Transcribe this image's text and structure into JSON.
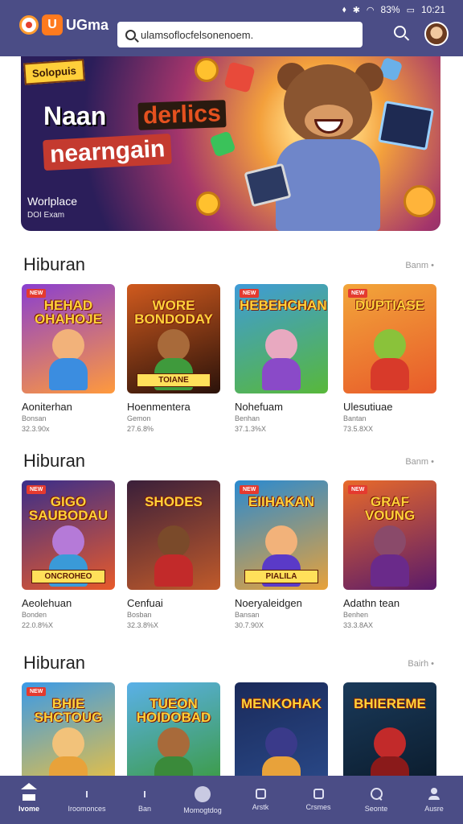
{
  "status_bar": {
    "battery": "83%",
    "time": "10:21"
  },
  "header": {
    "brand": "UGma",
    "search_value": "ulamsoflocfelsonenoem."
  },
  "banner": {
    "ribbon": "Solopuis",
    "title_line1_white": "Naan",
    "title_line1_box": "derlics",
    "title_line2": "nearngain",
    "subtitle": "Worlplace",
    "caption": "DOI Exam"
  },
  "sections": [
    {
      "title": "Hiburan",
      "more": "Banm",
      "cards": [
        {
          "art": "HEHAD OHAHOJE",
          "chip": "NEW",
          "foot": "",
          "name": "Aoniterhan",
          "meta1": "Bonsan",
          "meta2": "32.3.90x",
          "bg1": "#8a3fd0",
          "bg2": "#ff9a3c",
          "char": "#f2b27a",
          "body": "#3b8de0"
        },
        {
          "art": "WORE BONDODAY",
          "chip": "",
          "foot": "TOIANE",
          "name": "Hoenmentera",
          "meta1": "Gemon",
          "meta2": "27.6.8%",
          "bg1": "#d05a1e",
          "bg2": "#2a120a",
          "char": "#a86a3a",
          "body": "#3f9a3c"
        },
        {
          "art": "HEBEHCHAN",
          "chip": "NEW",
          "foot": "",
          "name": "Nohefuam",
          "meta1": "Benhan",
          "meta2": "37.1.3%X",
          "bg1": "#3f9bd8",
          "bg2": "#58b83a",
          "char": "#e8a9c0",
          "body": "#8a4ac8"
        },
        {
          "art": "DUPTIASE",
          "chip": "NEW",
          "foot": "",
          "name": "Ulesutiuae",
          "meta1": "Bantan",
          "meta2": "73.5.8XX",
          "bg1": "#f2a63a",
          "bg2": "#e85a2a",
          "char": "#8ac23a",
          "body": "#d83a2a"
        }
      ]
    },
    {
      "title": "Hiburan",
      "more": "Banm",
      "cards": [
        {
          "art": "GIGO SAUBODAU",
          "chip": "NEW",
          "foot": "ONCROHEO",
          "name": "Aeolehuan",
          "meta1": "Bonden",
          "meta2": "22.0.8%X",
          "bg1": "#3a2e8a",
          "bg2": "#e85a2a",
          "char": "#b57ad8",
          "body": "#3a9ad8"
        },
        {
          "art": "SHODES",
          "chip": "",
          "foot": "",
          "name": "Cenfuai",
          "meta1": "Bosban",
          "meta2": "32.3.8%X",
          "bg1": "#3a1f3a",
          "bg2": "#c05a2a",
          "char": "#7a4a2a",
          "body": "#c22a2a"
        },
        {
          "art": "EIIHAKAN",
          "chip": "NEW",
          "foot": "PIALILA",
          "name": "Noeryaleidgen",
          "meta1": "Bansan",
          "meta2": "30.7.90X",
          "bg1": "#2a8ad0",
          "bg2": "#e8a23a",
          "char": "#f2b27a",
          "body": "#5a3ac8"
        },
        {
          "art": "GRAF VOUNG",
          "chip": "NEW",
          "foot": "",
          "name": "Adathn tean",
          "meta1": "Benhen",
          "meta2": "33.3.8AX",
          "bg1": "#e86a2a",
          "bg2": "#5a1a6a",
          "char": "#8a4a6a",
          "body": "#6a2a8a"
        }
      ]
    },
    {
      "title": "Hiburan",
      "more": "Bairh",
      "cards": [
        {
          "art": "BHIE SHCTOUG",
          "chip": "NEW",
          "foot": "",
          "name": "",
          "meta1": "",
          "meta2": "",
          "bg1": "#3a9ae8",
          "bg2": "#f2c23a",
          "char": "#f2c27a",
          "body": "#e8a23a"
        },
        {
          "art": "TUEON HOIDOBAD",
          "chip": "",
          "foot": "",
          "name": "",
          "meta1": "",
          "meta2": "",
          "bg1": "#5ab0e8",
          "bg2": "#3a9a3a",
          "char": "#a86a3a",
          "body": "#3a8a3a"
        },
        {
          "art": "MENKOHAK",
          "chip": "",
          "foot": "",
          "name": "",
          "meta1": "",
          "meta2": "",
          "bg1": "#1a2a5a",
          "bg2": "#2a4a8a",
          "char": "#3a3a8a",
          "body": "#e8a23a"
        },
        {
          "art": "BHIEREME",
          "chip": "",
          "foot": "",
          "name": "",
          "meta1": "",
          "meta2": "",
          "bg1": "#1a3a5a",
          "bg2": "#0a1a2a",
          "char": "#c22a2a",
          "body": "#8a1a1a"
        }
      ]
    }
  ],
  "bottom_nav": [
    {
      "label": "Ivome",
      "icon": "home-icon",
      "active": true
    },
    {
      "label": "Iroomonces",
      "icon": "dot-icon",
      "active": false
    },
    {
      "label": "Ban",
      "icon": "dot-icon",
      "active": false
    },
    {
      "label": "Momogtdog",
      "icon": "circle-icon",
      "active": false
    },
    {
      "label": "Arstk",
      "icon": "square-icon",
      "active": false
    },
    {
      "label": "Crsmes",
      "icon": "square-icon",
      "active": false
    },
    {
      "label": "Seonte",
      "icon": "search-icon",
      "active": false
    },
    {
      "label": "Ausre",
      "icon": "user-icon",
      "active": false
    }
  ]
}
